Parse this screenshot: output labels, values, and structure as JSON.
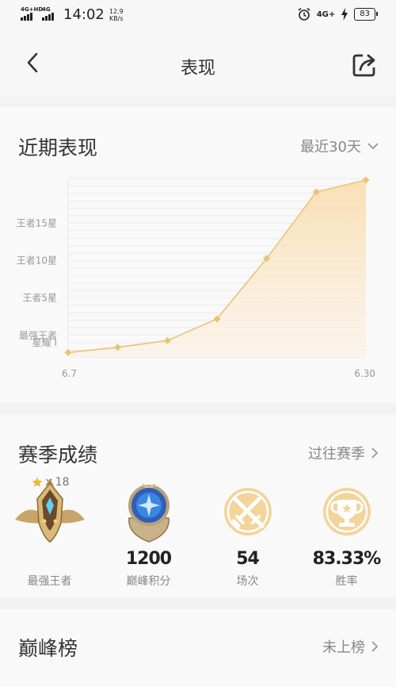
{
  "status_bar": {
    "network_1": "4G+HD",
    "network_2": "4G",
    "time": "14:02",
    "speed_value": "12.9",
    "speed_unit": "KB/s",
    "network_right": "4G+",
    "battery": "83"
  },
  "nav": {
    "title": "表现",
    "back_icon": "back-chevron-icon",
    "share_icon": "share-icon"
  },
  "performance": {
    "title": "近期表现",
    "period_label": "最近30天",
    "chart_data": {
      "type": "area",
      "title": "",
      "xlabel": "",
      "ylabel": "",
      "x_tick_labels": [
        "6.7",
        "6.30"
      ],
      "y_tick_labels": [
        "星耀 I",
        "最强王者",
        "王者5星",
        "王者10星",
        "王者15星"
      ],
      "ylim_note": "rank levels; 0 = 星耀 I, 1 = 最强王者, 6 = 王者5星, 11 = 王者10星, 16 = 王者15星",
      "ylim": [
        0,
        20
      ],
      "y_tick_values": [
        0,
        1,
        6,
        11,
        16
      ],
      "series": [
        {
          "values": [
            -1.3,
            -0.6,
            0.3,
            3.2,
            11.3,
            20.2,
            21.8
          ]
        }
      ],
      "color": "#e8c47a",
      "fill": "#fbe8c4",
      "grid": true
    }
  },
  "season": {
    "title": "赛季成绩",
    "link_label": "过往赛季",
    "stars_count": "18",
    "stats": [
      {
        "value": "",
        "label": "最强王者",
        "icon": "rank-emblem-icon"
      },
      {
        "value": "1200",
        "label": "巅峰积分",
        "icon": "peak-crest-icon"
      },
      {
        "value": "54",
        "label": "场次",
        "icon": "crossed-swords-icon"
      },
      {
        "value": "83.33%",
        "label": "胜率",
        "icon": "trophy-icon"
      }
    ]
  },
  "peak_rank": {
    "title": "巅峰榜",
    "status": "未上榜"
  }
}
